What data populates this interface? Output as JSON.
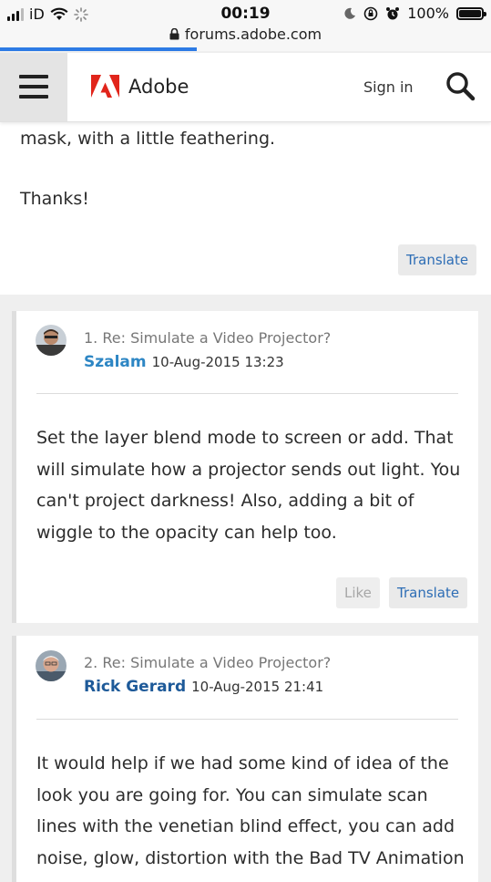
{
  "status_bar": {
    "carrier": "iD",
    "time": "00:19",
    "battery": "100%",
    "url": "forums.adobe.com",
    "page_load_progress": 0.4
  },
  "header": {
    "brand": "Adobe",
    "sign_in": "Sign in",
    "brand_color": "#e1251b"
  },
  "original_post": {
    "text_lines": [
      "mask, with a little feathering.",
      "Thanks!"
    ],
    "translate_label": "Translate"
  },
  "replies": [
    {
      "title": "1. Re: Simulate a Video Projector?",
      "author": "Szalam",
      "author_color": "#2d86c4",
      "date": "10-Aug-2015 13:23",
      "body": "Set the layer blend mode to screen or add. That will simulate how a projector sends out light. You can't project darkness! Also, adding a bit of wiggle to the opacity can help too.",
      "like_label": "Like",
      "translate_label": "Translate"
    },
    {
      "title": "2. Re: Simulate a Video Projector?",
      "author": "Rick Gerard",
      "author_color": "#1e5a99",
      "date": "10-Aug-2015 21:41",
      "body": "It would help if we had some kind of idea of the look you are going for. You can simulate scan lines with the venetian blind effect, you can add noise, glow, distortion with the Bad TV Animation"
    }
  ]
}
